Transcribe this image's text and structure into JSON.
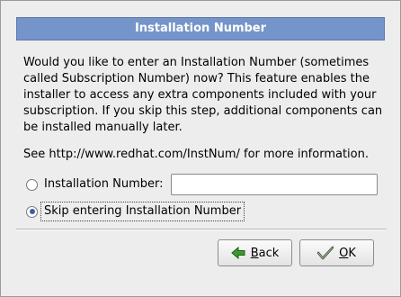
{
  "dialog": {
    "title": "Installation Number",
    "description": "Would you like to enter an Installation Number (sometimes called Subscription Number) now? This feature enables the installer to access any extra components included with your subscription.  If you skip this step, additional components can be installed manually later.",
    "info": "See http://www.redhat.com/InstNum/ for more information."
  },
  "options": {
    "enter_label": "Installation Number:",
    "enter_selected": false,
    "skip_label": "Skip entering Installation Number",
    "skip_selected": true
  },
  "input": {
    "value": ""
  },
  "buttons": {
    "back_mnemonic": "B",
    "back_rest": "ack",
    "ok_mnemonic": "O",
    "ok_rest": "K"
  },
  "icons": {
    "back": "back-arrow-icon",
    "ok": "check-icon"
  },
  "colors": {
    "title_bar": "#7594c9",
    "background": "#ededed"
  }
}
